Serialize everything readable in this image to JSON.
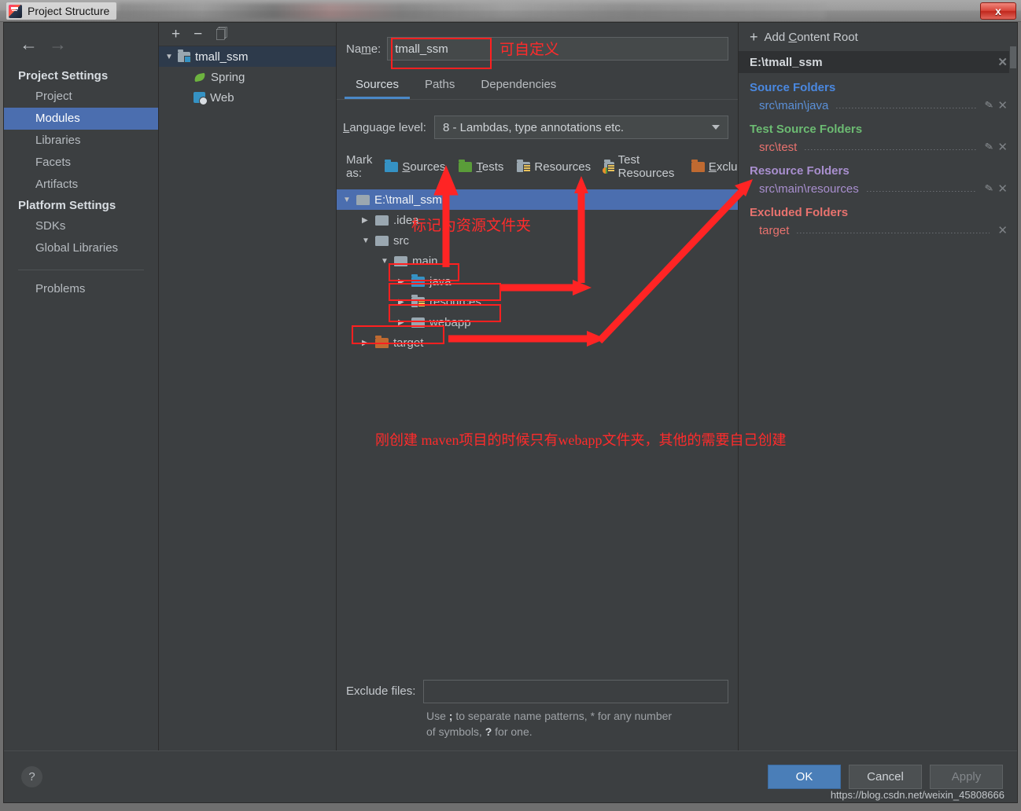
{
  "window": {
    "title": "Project Structure",
    "logo_icon": "intellij-idea-logo",
    "close_label": "x"
  },
  "sidebar": {
    "back_icon": "arrow-left-icon",
    "forward_icon": "arrow-right-icon",
    "groups": [
      {
        "title": "Project Settings",
        "items": [
          {
            "label": "Project",
            "selected": false
          },
          {
            "label": "Modules",
            "selected": true
          },
          {
            "label": "Libraries",
            "selected": false
          },
          {
            "label": "Facets",
            "selected": false
          },
          {
            "label": "Artifacts",
            "selected": false
          }
        ]
      },
      {
        "title": "Platform Settings",
        "items": [
          {
            "label": "SDKs",
            "selected": false
          },
          {
            "label": "Global Libraries",
            "selected": false
          }
        ]
      }
    ],
    "problems_label": "Problems"
  },
  "modules_panel": {
    "toolbar": {
      "add": "+",
      "remove": "−",
      "copy_icon": "copy-icon"
    },
    "tree": [
      {
        "label": "tmall_ssm",
        "icon": "module-icon",
        "selected": true,
        "expanded": true,
        "level": 0
      },
      {
        "label": "Spring",
        "icon": "spring-icon",
        "selected": false,
        "level": 1
      },
      {
        "label": "Web",
        "icon": "web-icon",
        "selected": false,
        "level": 1
      }
    ]
  },
  "editor": {
    "name_label": "Name:",
    "name_value": "tmall_ssm",
    "tabs": [
      {
        "label": "Sources",
        "active": true
      },
      {
        "label": "Paths",
        "active": false
      },
      {
        "label": "Dependencies",
        "active": false
      }
    ],
    "language_level_label": "Language level:",
    "language_level_value": "8 - Lambdas, type annotations etc.",
    "mark_as_label": "Mark as:",
    "mark_as_options": [
      {
        "label": "Sources",
        "color": "#3592c4",
        "kind": "sources"
      },
      {
        "label": "Tests",
        "color": "#5a9c39",
        "kind": "tests"
      },
      {
        "label": "Resources",
        "color": "#9aa7b0",
        "kind": "resources"
      },
      {
        "label": "Test Resources",
        "color": "#9aa7b0",
        "kind": "testresources"
      },
      {
        "label": "Excluded",
        "color": "#bf6a31",
        "kind": "excluded"
      }
    ],
    "folder_tree": [
      {
        "label": "E:\\tmall_ssm",
        "level": 0,
        "expanded": true,
        "selected": true,
        "folder_color": "#9aa7b0",
        "kind": "plain"
      },
      {
        "label": ".idea",
        "level": 1,
        "expanded": false,
        "selected": false,
        "folder_color": "#9aa7b0",
        "kind": "plain"
      },
      {
        "label": "src",
        "level": 1,
        "expanded": true,
        "selected": false,
        "folder_color": "#9aa7b0",
        "kind": "plain"
      },
      {
        "label": "main",
        "level": 2,
        "expanded": true,
        "selected": false,
        "folder_color": "#9aa7b0",
        "kind": "plain"
      },
      {
        "label": "java",
        "level": 3,
        "expanded": false,
        "selected": false,
        "folder_color": "#3592c4",
        "kind": "sources"
      },
      {
        "label": "resources",
        "level": 3,
        "expanded": false,
        "selected": false,
        "folder_color": "#9aa7b0",
        "kind": "resources"
      },
      {
        "label": "webapp",
        "level": 3,
        "expanded": false,
        "selected": false,
        "folder_color": "#9aa7b0",
        "kind": "plain"
      },
      {
        "label": "target",
        "level": 1,
        "expanded": false,
        "selected": false,
        "folder_color": "#bf6a31",
        "kind": "excluded"
      }
    ],
    "exclude_files_label": "Exclude files:",
    "exclude_files_value": "",
    "exclude_hint_1": "Use ",
    "exclude_hint_semicolon": ";",
    "exclude_hint_2": " to separate name patterns, * for any number of",
    "exclude_hint_3": "symbols, ",
    "exclude_hint_question": "?",
    "exclude_hint_4": " for one."
  },
  "right_panel": {
    "add_content_root_label": "Add Content Root",
    "add_icon": "plus-icon",
    "content_root": "E:\\tmall_ssm",
    "close_icon": "close-icon",
    "edit_icon": "pencil-icon",
    "groups": [
      {
        "title": "Source Folders",
        "color": "#4a88e0",
        "entries": [
          {
            "path": "src\\main\\java",
            "has_edit": true,
            "has_remove": true
          }
        ]
      },
      {
        "title": "Test Source Folders",
        "color": "#6cbb72",
        "entries": [
          {
            "path": "src\\test",
            "has_edit": true,
            "has_remove": true
          }
        ]
      },
      {
        "title": "Resource Folders",
        "color": "#a98fcf",
        "entries": [
          {
            "path": "src\\main\\resources",
            "has_edit": true,
            "has_remove": true
          }
        ]
      },
      {
        "title": "Excluded Folders",
        "color": "#e8726e",
        "entries": [
          {
            "path": "target",
            "has_edit": false,
            "has_remove": true
          }
        ]
      }
    ]
  },
  "footer": {
    "help_label": "?",
    "ok_label": "OK",
    "cancel_label": "Cancel",
    "apply_label": "Apply",
    "watermark": "https://blog.csdn.net/weixin_45808666"
  },
  "annotations": {
    "name_note": "可自定义",
    "src_note": "标记为资源文件夹",
    "bottom_note": "刚创建 maven项目的时候只有webapp文件夹，其他的需要自己创建",
    "color": "#ff2b2b"
  }
}
